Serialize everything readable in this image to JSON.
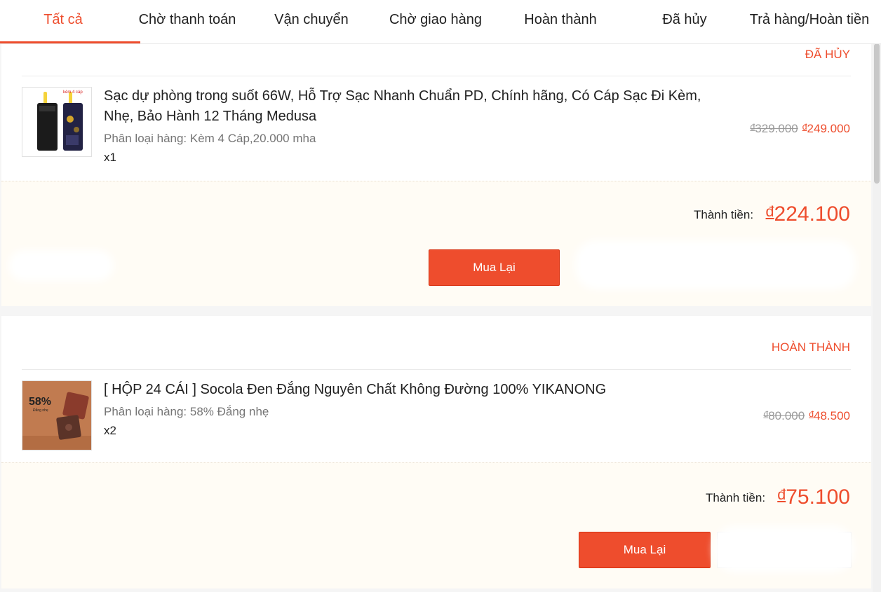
{
  "tabs": [
    {
      "label": "Tất cả",
      "active": true
    },
    {
      "label": "Chờ thanh toán"
    },
    {
      "label": "Vận chuyển"
    },
    {
      "label": "Chờ giao hàng"
    },
    {
      "label": "Hoàn thành"
    },
    {
      "label": "Đã hủy"
    },
    {
      "label": "Trả hàng/Hoàn tiền"
    }
  ],
  "orders": [
    {
      "status": "ĐÃ HỦY",
      "product": {
        "name": "Sạc dự phòng trong suốt 66W, Hỗ Trợ Sạc Nhanh Chuẩn PD, Chính hãng, Có Cáp Sạc Đi Kèm, Nhẹ, Bảo Hành 12 Tháng Medusa",
        "variant": "Phân loại hàng: Kèm 4 Cáp,20.000 mha",
        "quantity": "x1",
        "thumb_text": "kèm 4 cáp",
        "original_price": "329.000",
        "price": "249.000"
      },
      "total_label": "Thành tiền:",
      "total": "224.100",
      "rebuy_label": "Mua Lại"
    },
    {
      "status": "HOÀN THÀNH",
      "product": {
        "name": "[ HỘP 24 CÁI ] Socola Đen Đắng Nguyên Chất Không Đường 100% YIKANONG",
        "variant": "Phân loại hàng: 58% Đắng nhẹ",
        "quantity": "x2",
        "thumb_text": "58%",
        "thumb_subtext": "Đắng nhẹ",
        "original_price": "80.000",
        "price": "48.500"
      },
      "total_label": "Thành tiền:",
      "total": "75.100",
      "rebuy_label": "Mua Lại"
    }
  ],
  "currency_symbol": "đ",
  "colors": {
    "accent": "#ee4d2d",
    "footer_bg": "#fffcf5",
    "page_bg": "#f5f5f5"
  }
}
